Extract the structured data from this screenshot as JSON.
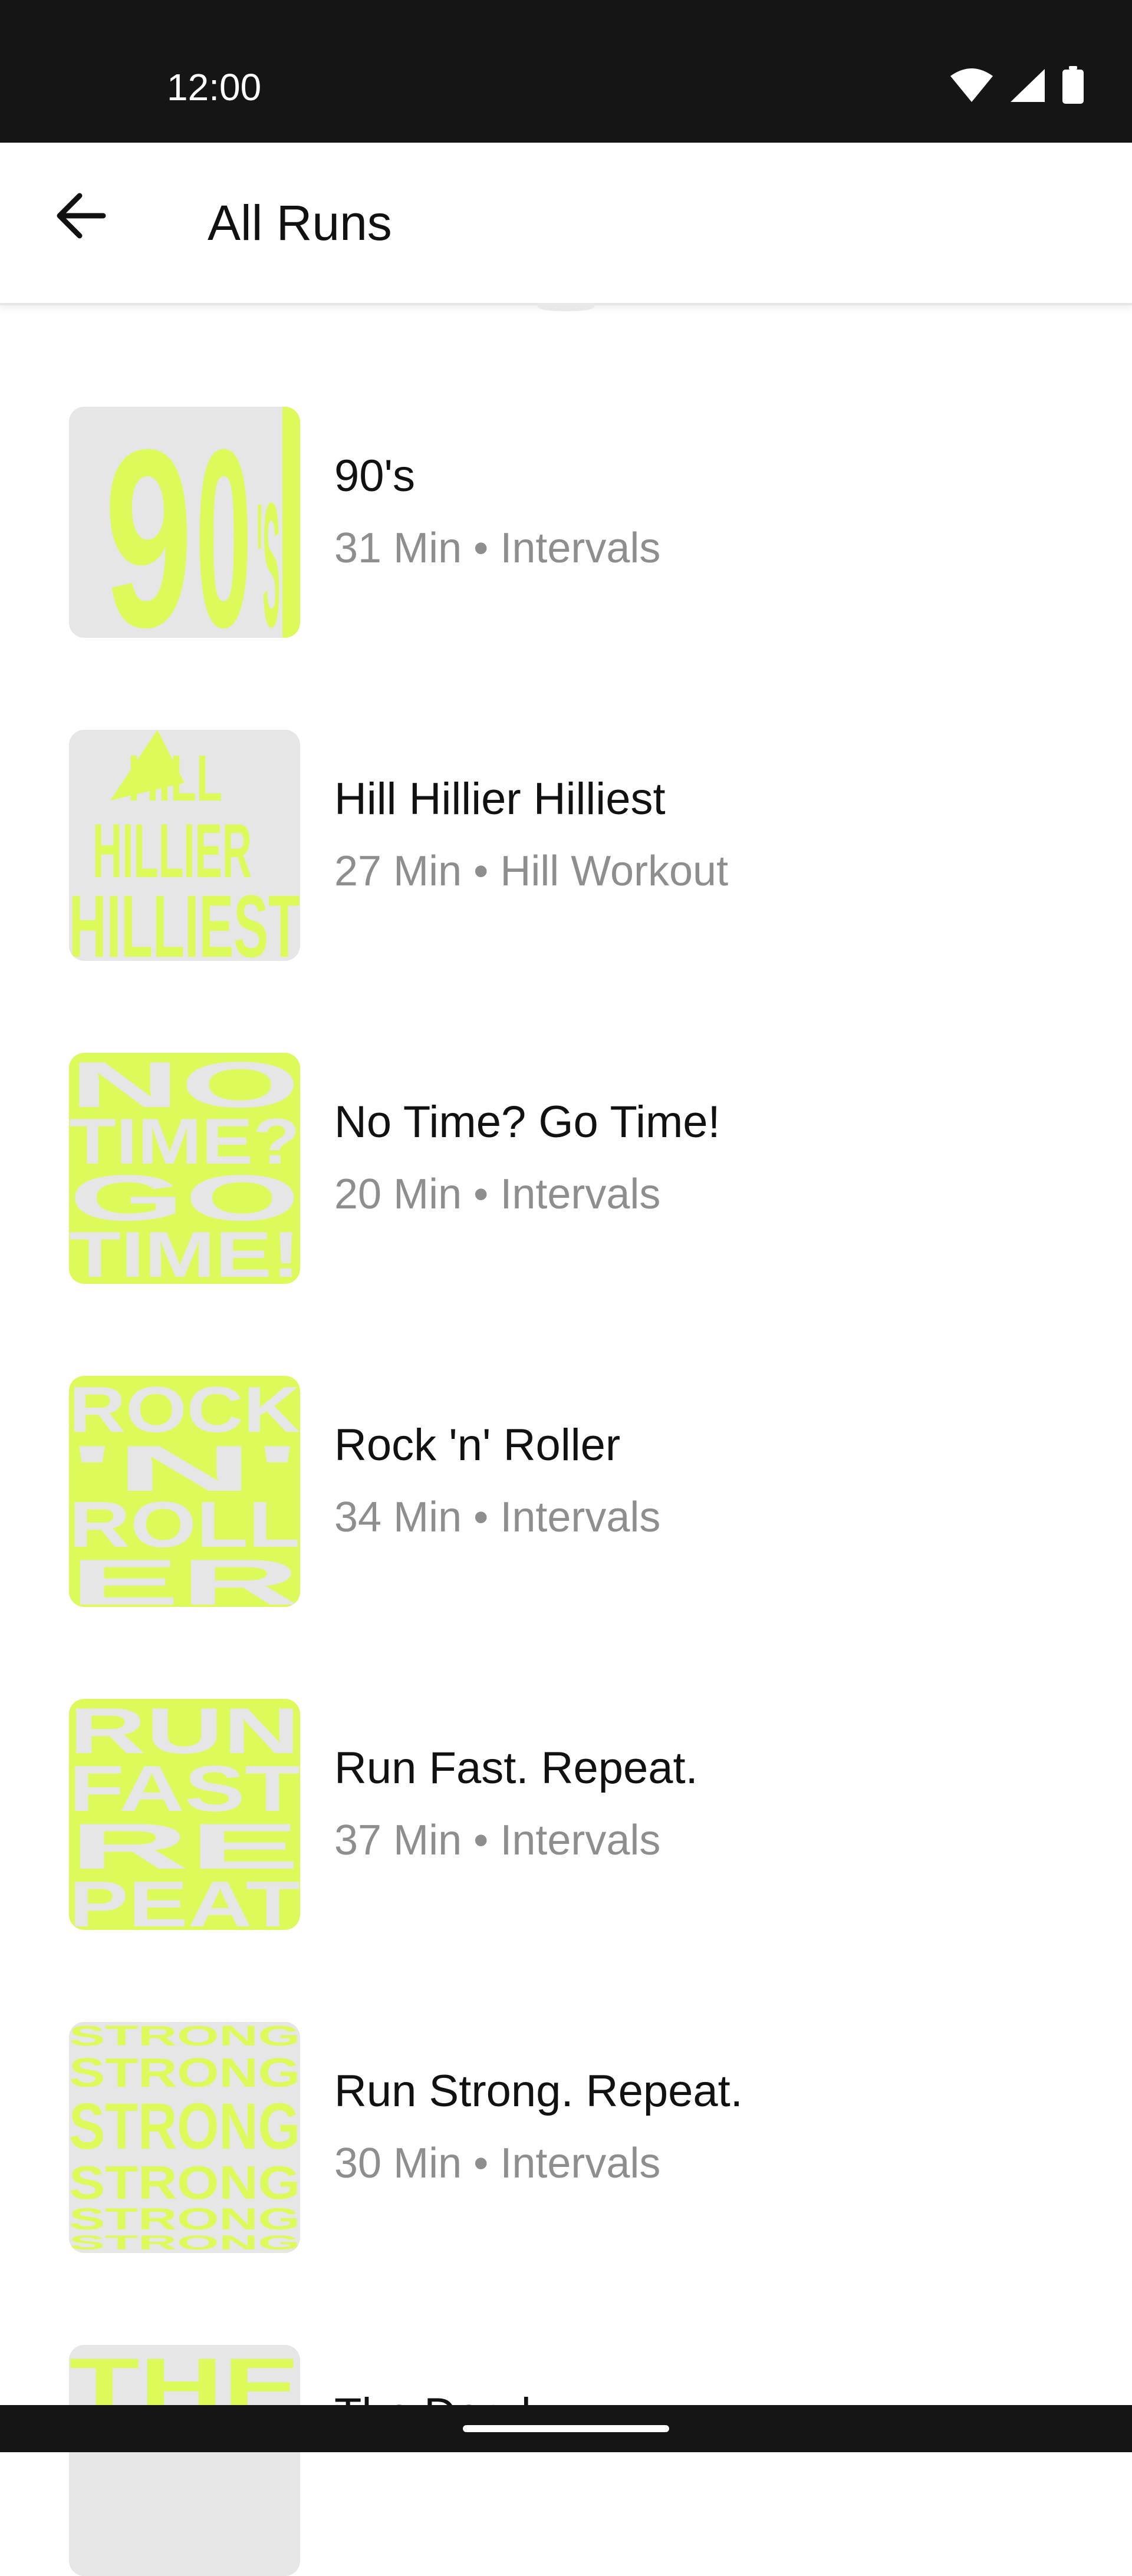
{
  "status_bar": {
    "time": "12:00",
    "icons": [
      "wifi-icon",
      "signal-icon",
      "battery-icon"
    ]
  },
  "app_bar": {
    "back_icon": "arrow-left-icon",
    "title": "All Runs"
  },
  "colors": {
    "accent": "#dcfb5a",
    "thumb_bg": "#e6e6e6",
    "title_text": "#111111",
    "subtitle_text": "#8e8e8e"
  },
  "runs": [
    {
      "title": "90's",
      "subtitle": "31 Min • Intervals"
    },
    {
      "title": "Hill Hillier Hilliest",
      "subtitle": "27 Min • Hill Workout"
    },
    {
      "title": "No Time? Go Time!",
      "subtitle": "20 Min • Intervals"
    },
    {
      "title": "Rock 'n' Roller",
      "subtitle": "34 Min • Intervals"
    },
    {
      "title": "Run Fast. Repeat.",
      "subtitle": "37 Min • Intervals"
    },
    {
      "title": "Run Strong. Repeat.",
      "subtitle": "30 Min • Intervals"
    },
    {
      "title": "The Dead...",
      "subtitle": ""
    }
  ]
}
